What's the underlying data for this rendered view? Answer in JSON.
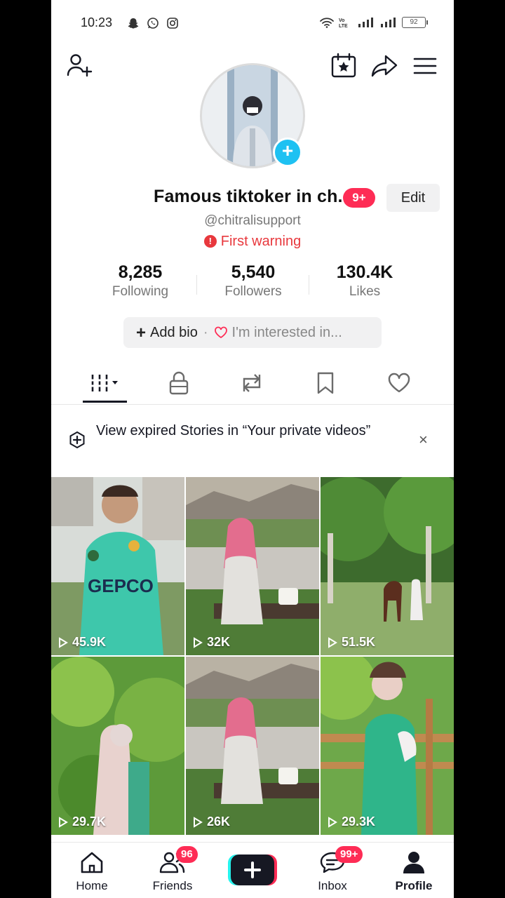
{
  "status": {
    "time": "10:23",
    "battery": "92"
  },
  "profile": {
    "display_name": "Famous tiktoker in ch...",
    "notif_badge": "9+",
    "edit_label": "Edit",
    "username": "@chitralisupport",
    "warning": "First warning"
  },
  "stats": [
    {
      "value": "8,285",
      "label": "Following"
    },
    {
      "value": "5,540",
      "label": "Followers"
    },
    {
      "value": "130.4K",
      "label": "Likes"
    }
  ],
  "bio": {
    "add_label": "Add bio",
    "separator": "·",
    "interest_label": "I'm interested in..."
  },
  "notice": {
    "text": "View expired Stories in “Your private videos”",
    "close": "×"
  },
  "videos": [
    {
      "views": "45.9K"
    },
    {
      "views": "32K"
    },
    {
      "views": "51.5K"
    },
    {
      "views": "29.7K"
    },
    {
      "views": "26K"
    },
    {
      "views": "29.3K"
    }
  ],
  "nav": {
    "home": "Home",
    "friends": "Friends",
    "friends_badge": "96",
    "inbox": "Inbox",
    "inbox_badge": "99+",
    "profile": "Profile"
  },
  "colors": {
    "accent": "#fe2c55",
    "cyan": "#25f4ee",
    "avatar_plus": "#1ec1f2",
    "warning": "#e8383d"
  }
}
